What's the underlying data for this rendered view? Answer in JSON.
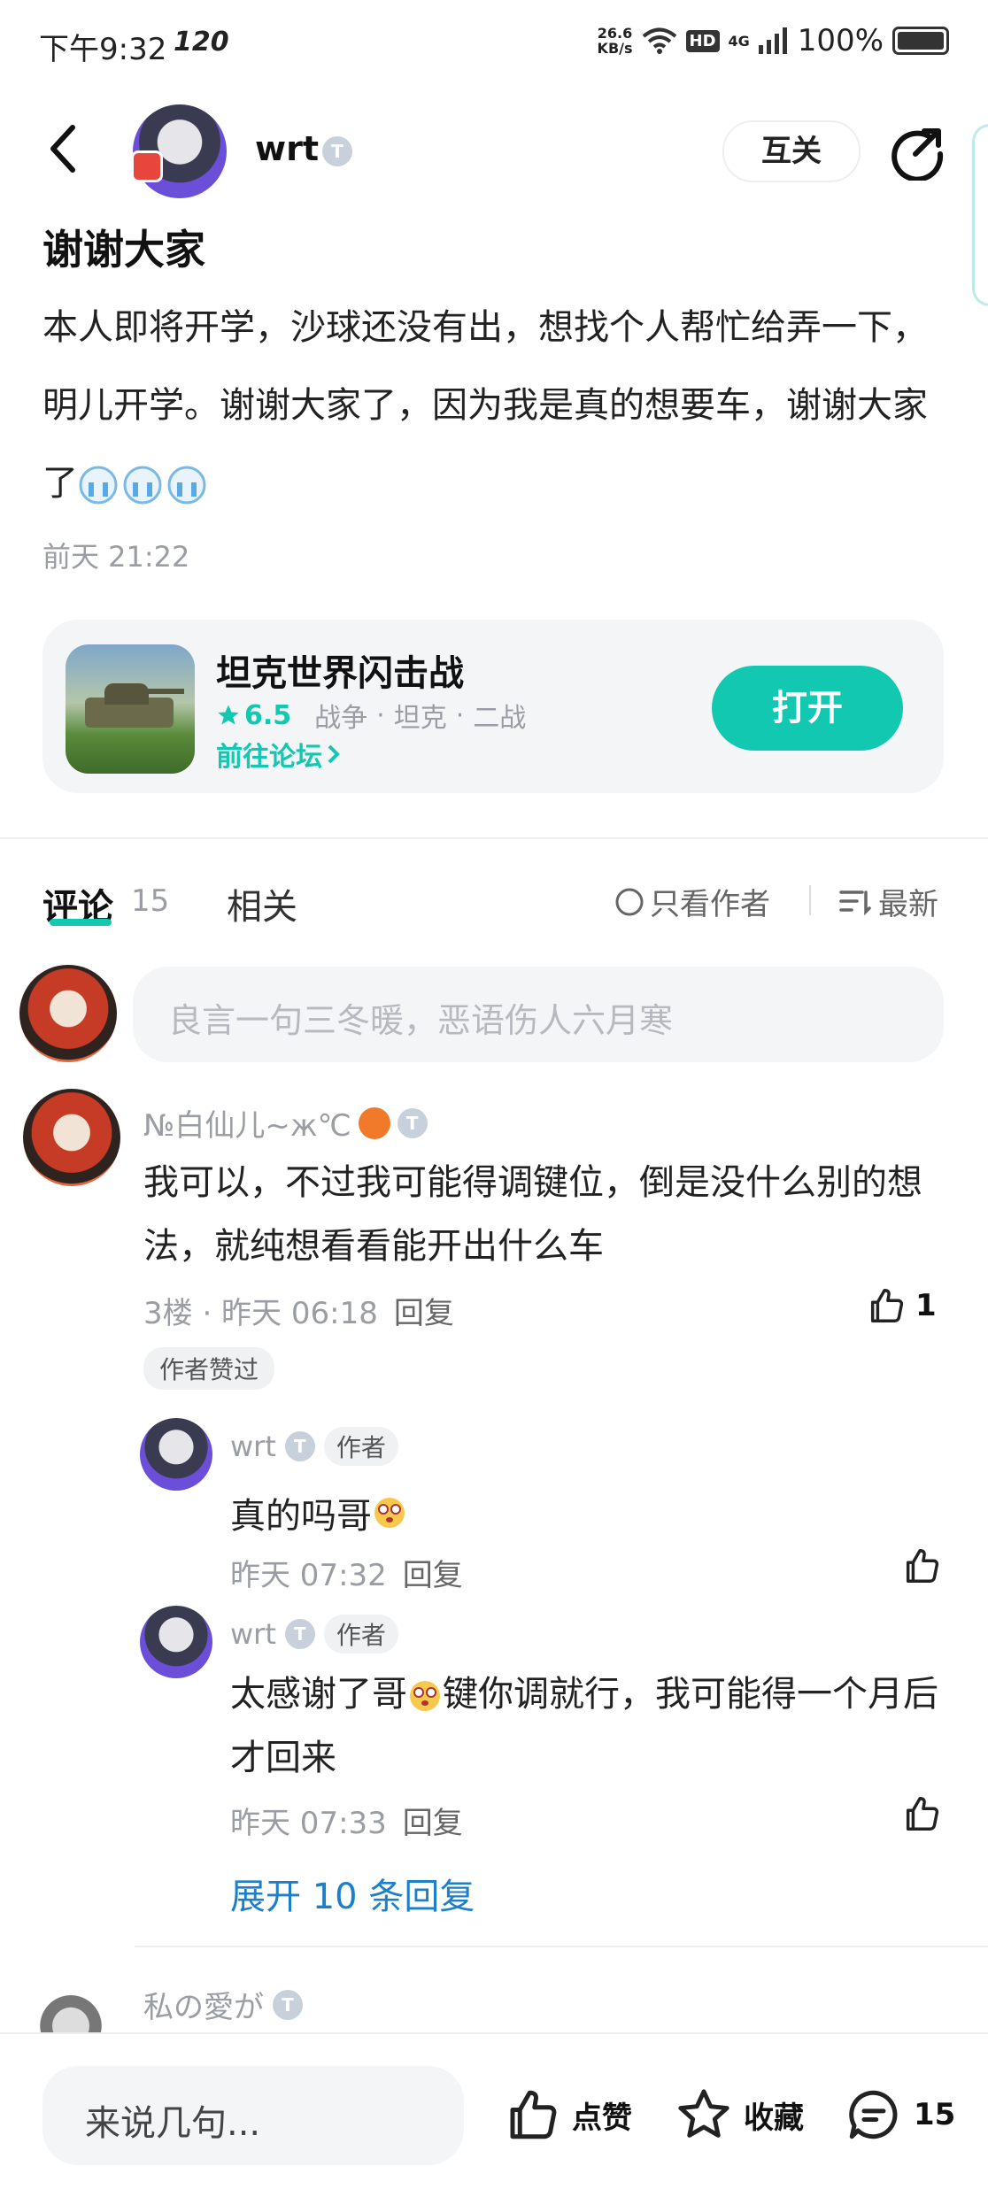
{
  "status_bar": {
    "time": "下午9:32",
    "refresh": "120",
    "net_speed_value": "26.6",
    "net_speed_unit": "KB/s",
    "network": "4G",
    "hd": "HD",
    "battery": "100%"
  },
  "header": {
    "author_name": "wrt",
    "mutual_button": "互关"
  },
  "post": {
    "title": "谢谢大家",
    "body": "本人即将开学，沙球还没有出，想找个人帮忙给弄一下，明儿开学。谢谢大家了，因为我是真的想要车，谢谢大家了",
    "time": "前天 21:22"
  },
  "game_card": {
    "name": "坦克世界闪击战",
    "rating": "6.5",
    "tags": [
      "战争",
      "坦克",
      "二战"
    ],
    "forum_link": "前往论坛",
    "open_button": "打开"
  },
  "tabs": {
    "comments": "评论",
    "comments_count": "15",
    "related": "相关",
    "only_author": "只看作者",
    "sort": "最新"
  },
  "comment_input": {
    "placeholder": "良言一句三冬暖，恶语伤人六月寒"
  },
  "comments": [
    {
      "name": "№白仙儿~ж℃",
      "text": "我可以，不过我可能得调键位，倒是没什么别的想法，就纯想看看能开出什么车",
      "meta": "3楼 · 昨天 06:18",
      "reply": "回复",
      "likes": "1",
      "liked_by_author": "作者赞过",
      "replies": [
        {
          "name": "wrt",
          "tag": "作者",
          "text": "真的吗哥",
          "time": "昨天 07:32",
          "reply": "回复"
        },
        {
          "name": "wrt",
          "tag": "作者",
          "text_before": "太感谢了哥",
          "text_after": "键你调就行，我可能得一个月后才回来",
          "time": "昨天 07:33",
          "reply": "回复"
        }
      ],
      "expand": "展开 10 条回复"
    },
    {
      "name": "私の愛が"
    }
  ],
  "bottom_bar": {
    "input_placeholder": "来说几句...",
    "like": "点赞",
    "favorite": "收藏",
    "comment_count": "15"
  },
  "colors": {
    "accent": "#12c8b0",
    "link": "#1c7fc9",
    "muted": "#9a9da3"
  }
}
